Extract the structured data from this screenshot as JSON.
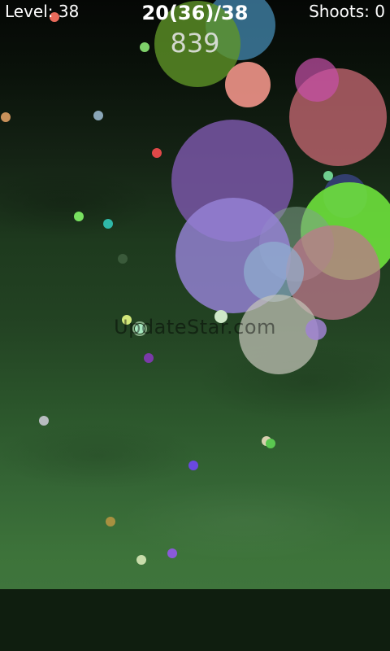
{
  "hud": {
    "level": "Level: 38",
    "progress": "20(36)/38",
    "shoots": "Shoots: 0",
    "score": "839"
  },
  "watermark": "UpdateStar.com",
  "colors": {
    "background_top": "#050705",
    "background_bottom": "#3f753c",
    "bottom_bar": "#0f1e0f"
  }
}
